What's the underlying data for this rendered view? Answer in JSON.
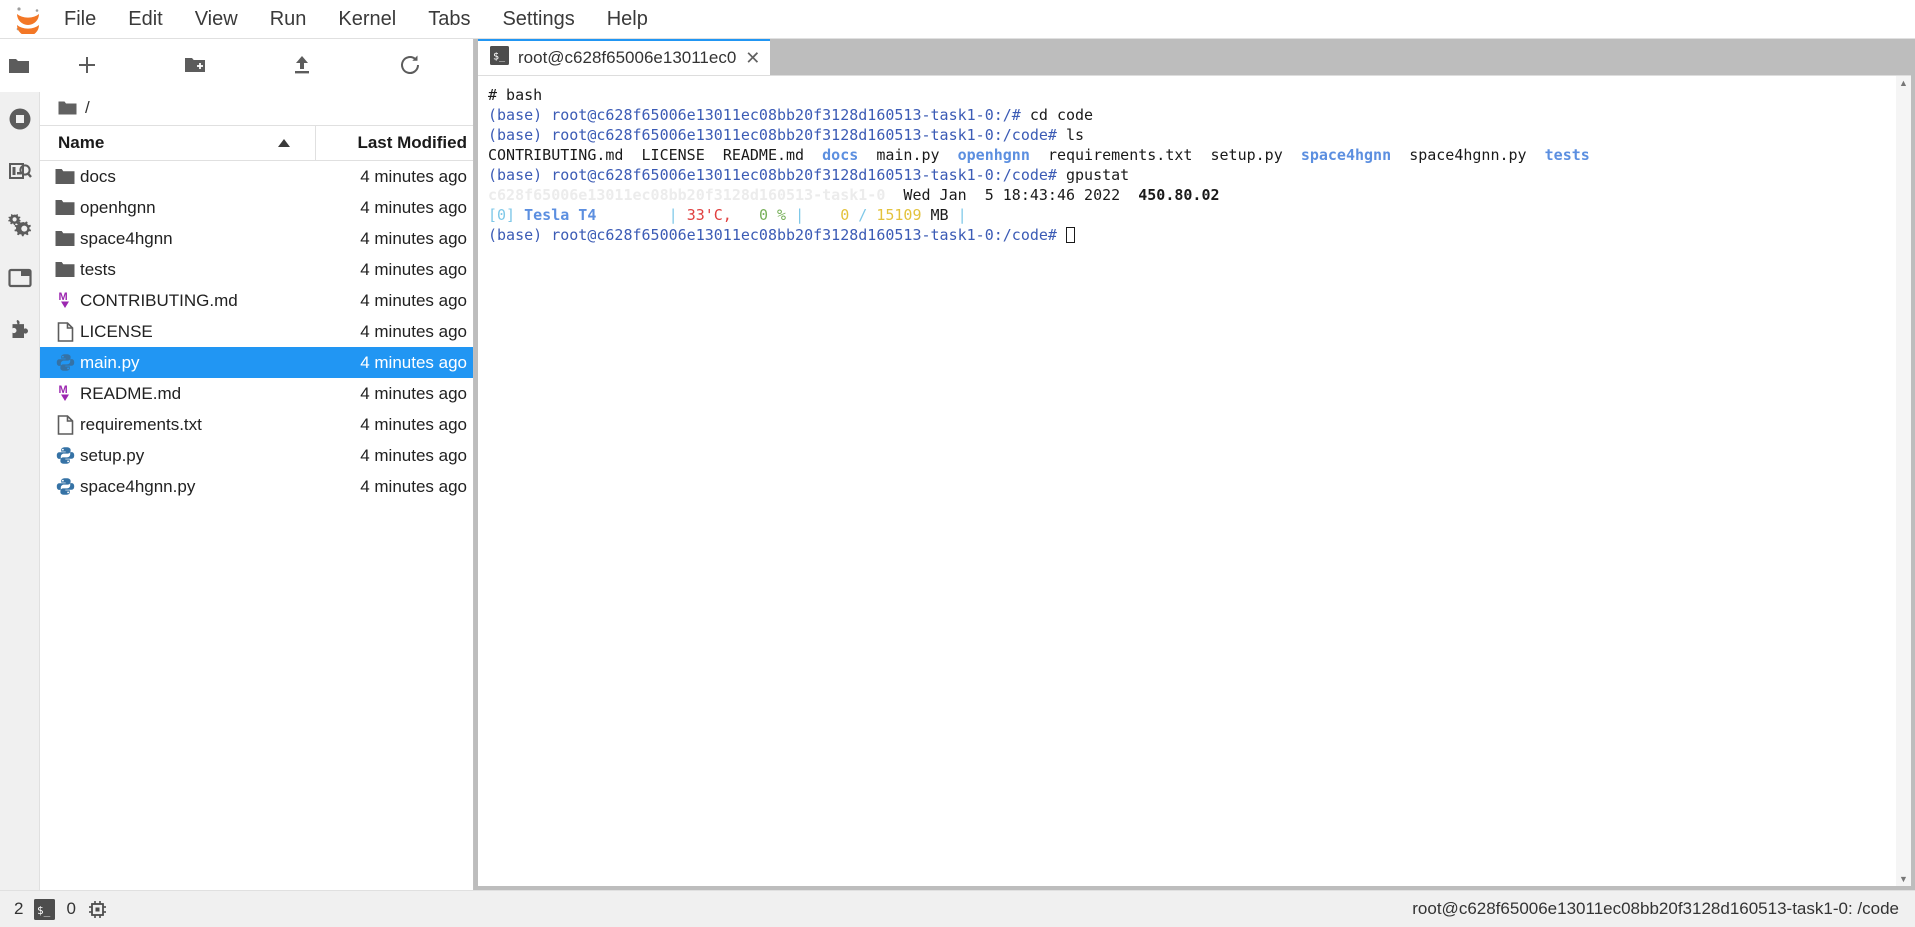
{
  "app": {
    "logo_icon": "jupyter-logo"
  },
  "menubar": {
    "items": [
      {
        "label": "File"
      },
      {
        "label": "Edit"
      },
      {
        "label": "View"
      },
      {
        "label": "Run"
      },
      {
        "label": "Kernel"
      },
      {
        "label": "Tabs"
      },
      {
        "label": "Settings"
      },
      {
        "label": "Help"
      }
    ]
  },
  "activitybar": {
    "items": [
      {
        "icon": "folder-icon",
        "name": "file-browser",
        "active": true
      },
      {
        "icon": "running-stop-icon",
        "name": "running-terminals-kernels"
      },
      {
        "icon": "command-palette-icon",
        "name": "commands"
      },
      {
        "icon": "gears-icon",
        "name": "property-inspector"
      },
      {
        "icon": "tab-window-icon",
        "name": "open-tabs"
      },
      {
        "icon": "puzzle-icon",
        "name": "extension-manager"
      }
    ]
  },
  "filebrowser": {
    "toolbar": [
      {
        "icon": "plus-icon",
        "name": "new-launcher",
        "label": "+"
      },
      {
        "icon": "new-folder-icon",
        "name": "new-folder"
      },
      {
        "icon": "upload-icon",
        "name": "upload-files"
      },
      {
        "icon": "refresh-icon",
        "name": "refresh-file-list"
      }
    ],
    "breadcrumb": {
      "root_icon": "folder-icon",
      "path": "/"
    },
    "columns": {
      "name": "Name",
      "last_modified": "Last Modified",
      "sort_direction": "ascending"
    },
    "items": [
      {
        "name": "docs",
        "kind": "folder",
        "icon": "folder-icon",
        "modified": "4 minutes ago",
        "selected": false
      },
      {
        "name": "openhgnn",
        "kind": "folder",
        "icon": "folder-icon",
        "modified": "4 minutes ago",
        "selected": false
      },
      {
        "name": "space4hgnn",
        "kind": "folder",
        "icon": "folder-icon",
        "modified": "4 minutes ago",
        "selected": false
      },
      {
        "name": "tests",
        "kind": "folder",
        "icon": "folder-icon",
        "modified": "4 minutes ago",
        "selected": false
      },
      {
        "name": "CONTRIBUTING.md",
        "kind": "markdown",
        "icon": "markdown-icon",
        "modified": "4 minutes ago",
        "selected": false
      },
      {
        "name": "LICENSE",
        "kind": "file",
        "icon": "file-icon",
        "modified": "4 minutes ago",
        "selected": false
      },
      {
        "name": "main.py",
        "kind": "python",
        "icon": "python-icon",
        "modified": "4 minutes ago",
        "selected": true
      },
      {
        "name": "README.md",
        "kind": "markdown",
        "icon": "markdown-icon",
        "modified": "4 minutes ago",
        "selected": false
      },
      {
        "name": "requirements.txt",
        "kind": "file",
        "icon": "file-icon",
        "modified": "4 minutes ago",
        "selected": false
      },
      {
        "name": "setup.py",
        "kind": "python",
        "icon": "python-icon",
        "modified": "4 minutes ago",
        "selected": false
      },
      {
        "name": "space4hgnn.py",
        "kind": "python",
        "icon": "python-icon",
        "modified": "4 minutes ago",
        "selected": false
      }
    ]
  },
  "dock": {
    "tabs": [
      {
        "label": "root@c628f65006e13011ec0",
        "icon": "terminal-icon",
        "close": "✕",
        "active": true
      }
    ]
  },
  "terminal": {
    "shell_header": "# bash",
    "prompt_env": "(base)",
    "host_root": "root@c628f65006e13011ec08bb20f3128d160513-task1-0:/#",
    "host_code": "root@c628f65006e13011ec08bb20f3128d160513-task1-0:/code#",
    "cmd_cd": "cd code",
    "cmd_ls": "ls",
    "cmd_gpustat": "gpustat",
    "ls_output": [
      {
        "text": "CONTRIBUTING.md",
        "color": "plain"
      },
      {
        "text": "LICENSE",
        "color": "plain"
      },
      {
        "text": "README.md",
        "color": "plain"
      },
      {
        "text": "docs",
        "color": "blue"
      },
      {
        "text": "main.py",
        "color": "plain"
      },
      {
        "text": "openhgnn",
        "color": "blue"
      },
      {
        "text": "requirements.txt",
        "color": "plain"
      },
      {
        "text": "setup.py",
        "color": "plain"
      },
      {
        "text": "space4hgnn",
        "color": "blue"
      },
      {
        "text": "space4hgnn.py",
        "color": "plain"
      },
      {
        "text": "tests",
        "color": "blue"
      }
    ],
    "gpustat_host": "c628f65006e13011ec08bb20f3128d160513-task1-0",
    "gpustat_date": "Wed Jan  5 18:43:46 2022",
    "gpustat_driver": "450.80.02",
    "gpu": {
      "index": "[0]",
      "name": "Tesla T4",
      "temperature": "33'C,",
      "utilization": "0 %",
      "mem_used": "0",
      "mem_sep": "/",
      "mem_total": "15109",
      "mem_unit": "MB",
      "bar": "|"
    },
    "scrollbar": {
      "up": "▲",
      "down": "▼"
    }
  },
  "statusbar": {
    "kernels_count": "2",
    "terminal_icon": "terminal-icon",
    "busy_count": "0",
    "cpu_icon": "cpu-chip-icon",
    "right_text": "root@c628f65006e13011ec08bb20f3128d160513-task1-0: /code"
  },
  "colors": {
    "accent": "#2196f3",
    "jupyter_orange": "#f37726",
    "markdown_purple": "#9c27b0",
    "python_blue": "#3572A5",
    "terminal_blue": "#5c8fe0"
  }
}
